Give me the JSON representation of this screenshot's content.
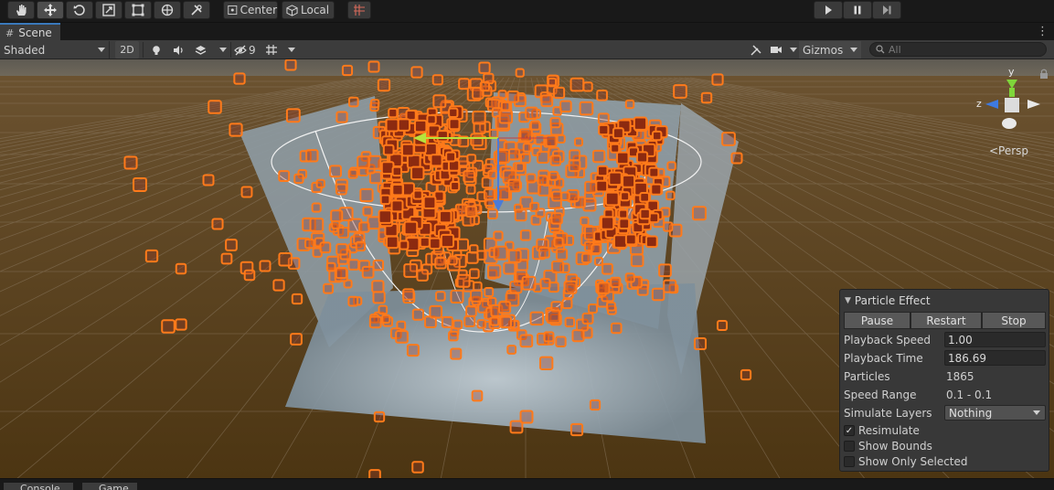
{
  "toolbar": {
    "tools": [
      {
        "name": "hand-tool",
        "icon": "hand-icon"
      },
      {
        "name": "move-tool",
        "icon": "move-icon",
        "active": true
      },
      {
        "name": "rotate-tool",
        "icon": "rotate-icon"
      },
      {
        "name": "scale-tool",
        "icon": "scale-icon"
      },
      {
        "name": "rect-tool",
        "icon": "rect-icon"
      },
      {
        "name": "transform-tool",
        "icon": "transform-icon"
      },
      {
        "name": "custom-tool",
        "icon": "tools-icon"
      }
    ],
    "pivot_label": "Center",
    "space_label": "Local",
    "play_icon": "play-icon",
    "pause_icon": "pause-icon",
    "step_icon": "step-icon"
  },
  "tabs": {
    "scene_label": "Scene"
  },
  "scenebar": {
    "draw_mode": "Shaded",
    "mode_2d": "2D",
    "hidden_count": "9",
    "gizmos_label": "Gizmos",
    "search_placeholder": "All"
  },
  "gizmo": {
    "y_label": "y",
    "z_label": "z",
    "x_label": "x",
    "projection": "<Persp"
  },
  "particle_effect": {
    "title": "Particle Effect",
    "buttons": {
      "pause": "Pause",
      "restart": "Restart",
      "stop": "Stop"
    },
    "playback_speed_label": "Playback Speed",
    "playback_speed_value": "1.00",
    "playback_time_label": "Playback Time",
    "playback_time_value": "186.69",
    "particles_label": "Particles",
    "particles_value": "1865",
    "speed_range_label": "Speed Range",
    "speed_range_value": "0.1 - 0.1",
    "simulate_layers_label": "Simulate Layers",
    "simulate_layers_value": "Nothing",
    "resimulate_label": "Resimulate",
    "resimulate_checked": true,
    "show_bounds_label": "Show Bounds",
    "show_only_selected_label": "Show Only Selected"
  },
  "bottom_tabs": {
    "console_label": "Console",
    "game_label": "Game"
  },
  "colors": {
    "ground": "#5a3f1a",
    "sky": "#6b6458",
    "particle": "#ff7a1a",
    "particle_core": "#8c2a10",
    "accent_blue": "#3a79bb"
  }
}
